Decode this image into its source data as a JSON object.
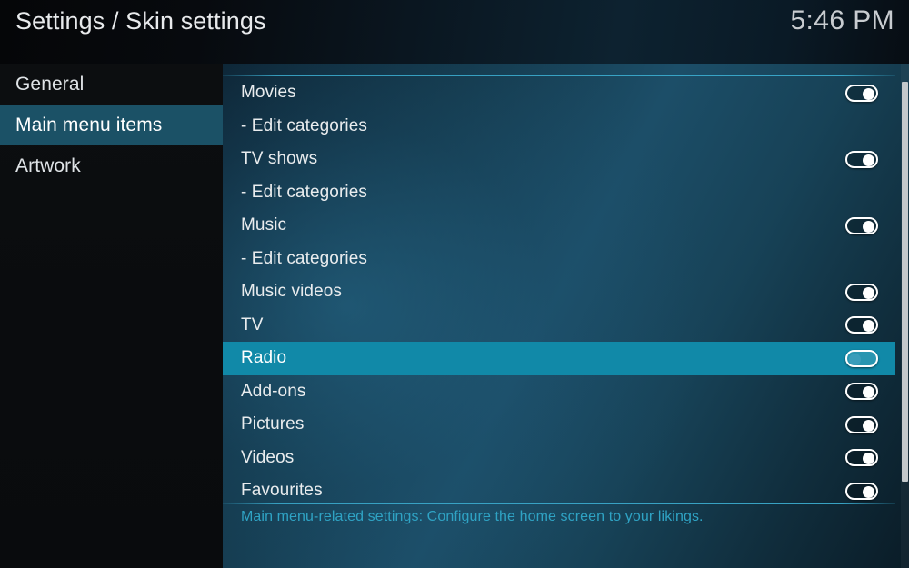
{
  "header": {
    "title": "Settings / Skin settings",
    "clock": "5:46 PM"
  },
  "sidebar": {
    "items": [
      {
        "label": "General",
        "selected": false
      },
      {
        "label": "Main menu items",
        "selected": true
      },
      {
        "label": "Artwork",
        "selected": false
      }
    ]
  },
  "main": {
    "rows": [
      {
        "label": "Movies",
        "toggle": "on",
        "has_toggle": true,
        "selected": false
      },
      {
        "label": "- Edit categories",
        "toggle": null,
        "has_toggle": false,
        "selected": false
      },
      {
        "label": "TV shows",
        "toggle": "on",
        "has_toggle": true,
        "selected": false
      },
      {
        "label": "- Edit categories",
        "toggle": null,
        "has_toggle": false,
        "selected": false
      },
      {
        "label": "Music",
        "toggle": "on",
        "has_toggle": true,
        "selected": false
      },
      {
        "label": "- Edit categories",
        "toggle": null,
        "has_toggle": false,
        "selected": false
      },
      {
        "label": "Music videos",
        "toggle": "on",
        "has_toggle": true,
        "selected": false
      },
      {
        "label": "TV",
        "toggle": "on",
        "has_toggle": true,
        "selected": false
      },
      {
        "label": "Radio",
        "toggle": "off",
        "has_toggle": true,
        "selected": true
      },
      {
        "label": "Add-ons",
        "toggle": "on",
        "has_toggle": true,
        "selected": false
      },
      {
        "label": "Pictures",
        "toggle": "on",
        "has_toggle": true,
        "selected": false
      },
      {
        "label": "Videos",
        "toggle": "on",
        "has_toggle": true,
        "selected": false
      },
      {
        "label": "Favourites",
        "toggle": "on",
        "has_toggle": true,
        "selected": false
      }
    ],
    "description": "Main menu-related settings: Configure the home screen to your likings."
  },
  "colors": {
    "selection_highlight": "#1189a8",
    "sidebar_highlight": "#1b5166",
    "divider_teal": "#3cafd2",
    "description_text": "#2fa3c4",
    "scrollbar_thumb": "#c3c8cb"
  }
}
